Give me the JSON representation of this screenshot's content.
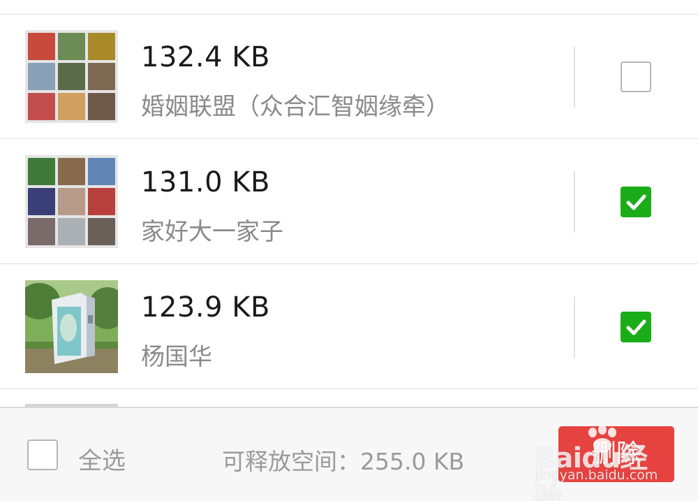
{
  "items": [
    {
      "size": "132.4 KB",
      "name": "婚姻联盟（众合汇智姻缘牵）",
      "checked": false,
      "thumbnail": "group-avatar-grid",
      "thumb_colors": [
        "#c84a3c",
        "#6d8b55",
        "#a88a2a",
        "#8aa0b8",
        "#5a6b4a",
        "#7d6a52",
        "#c24e4e",
        "#d0a060",
        "#6e5a48"
      ]
    },
    {
      "size": "131.0 KB",
      "name": "家好大一家子",
      "checked": true,
      "thumbnail": "group-avatar-grid",
      "thumb_colors": [
        "#3f7a3a",
        "#8a6a4e",
        "#5f86b6",
        "#3a3f78",
        "#b89a8a",
        "#b8403c",
        "#7a6a6a",
        "#aab0b4",
        "#6b6058"
      ]
    },
    {
      "size": "123.9 KB",
      "name": "杨国华",
      "checked": true,
      "thumbnail": "photo-kiosk"
    }
  ],
  "footer": {
    "select_all_label": "全选",
    "space_label": "可释放空间：255.0 KB",
    "delete_label": "删除"
  },
  "watermark": {
    "text": "Baidu经验",
    "url": "jingyan.baidu.com"
  },
  "colors": {
    "accent_green": "#1aad19",
    "delete_red": "#e64340",
    "text_secondary": "#8a8a8a"
  }
}
